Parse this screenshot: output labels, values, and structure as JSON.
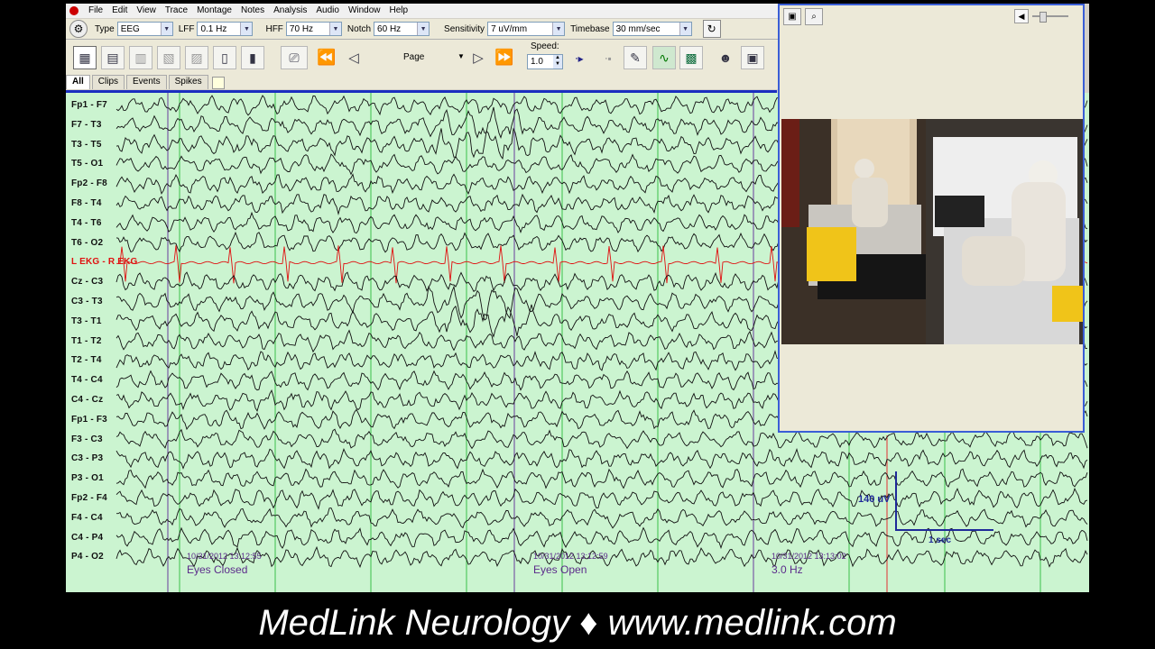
{
  "menu": {
    "items": [
      "File",
      "Edit",
      "View",
      "Trace",
      "Montage",
      "Notes",
      "Analysis",
      "Audio",
      "Window",
      "Help"
    ]
  },
  "toolbar": {
    "type_label": "Type",
    "type_value": "EEG",
    "lff_label": "LFF",
    "lff_value": "0.1 Hz",
    "hff_label": "HFF",
    "hff_value": "70 Hz",
    "notch_label": "Notch",
    "notch_value": "60 Hz",
    "sensitivity_label": "Sensitivity",
    "sensitivity_value": "7 uV/mm",
    "timebase_label": "Timebase",
    "timebase_value": "30 mm/sec"
  },
  "nav": {
    "page_label": "Page",
    "speed_label": "Speed:",
    "speed_value": "1.0"
  },
  "tabs": [
    "All",
    "Clips",
    "Events",
    "Spikes"
  ],
  "channels": [
    "Fp1 - F7",
    "F7 - T3",
    "T3 - T5",
    "T5 - O1",
    "Fp2 - F8",
    "F8 - T4",
    "T4 - T6",
    "T6 - O2",
    "L EKG - R EKG",
    "Cz - C3",
    "C3 - T3",
    "T3 - T1",
    "T1 - T2",
    "T2 - T4",
    "T4 - C4",
    "C4 - Cz",
    "Fp1 - F3",
    "F3 - C3",
    "C3 - P3",
    "P3 - O1",
    "Fp2 - F4",
    "F4 - C4",
    "C4 - P4",
    "P4 - O2"
  ],
  "events": [
    {
      "timestamp": "10/31/2012 13:12:55",
      "label": "Eyes Closed"
    },
    {
      "timestamp": "10/31/2012 13:12:59",
      "label": "Eyes Open"
    },
    {
      "timestamp": "10/31/2012 13:13:02",
      "label": "3.0 Hz"
    }
  ],
  "calibration": {
    "amplitude": "140 uV",
    "time": "1 sec"
  },
  "colors": {
    "background": "#cbf4d0",
    "trace": "#111111",
    "ekg": "#e01010",
    "event_text": "#5b2a8a",
    "secondary_grid": "#22aa33"
  },
  "footer": {
    "text": "MedLink Neurology ♦ www.medlink.com"
  }
}
